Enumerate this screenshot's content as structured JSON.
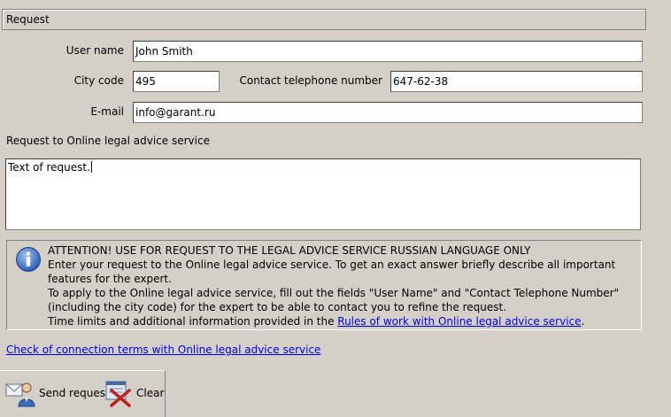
{
  "section": {
    "title": "Request"
  },
  "form": {
    "user_name_label": "User name",
    "user_name_value": "John Smith",
    "city_code_label": "City code",
    "city_code_value": "495",
    "phone_label": "Contact telephone number",
    "phone_value": "647-62-38",
    "email_label": "E-mail",
    "email_value": "info@garant.ru",
    "request_label": "Request to Online legal advice service",
    "request_text": "Text of request."
  },
  "notice": {
    "icon": "info-icon",
    "heading": "ATTENTION! USE FOR REQUEST TO THE LEGAL ADVICE SERVICE RUSSIAN LANGUAGE ONLY",
    "line1": "Enter your request to the Online legal advice service. To get an exact answer briefly describe all important features for the expert.",
    "line2": "To apply to the Online legal advice service, fill out the fields \"User Name\" and \"Contact Telephone Number\" (including the city code) for the expert to be able to contact you to refine the request.",
    "line3_prefix": "Time limits and additional information provided in the ",
    "rules_link": "Rules of work with Online legal advice service",
    "line3_suffix": "."
  },
  "check_link": "Check of connection terms with Online legal advice service",
  "toolbar": {
    "send_label": "Send request",
    "send_icon": "send-request-icon",
    "clear_label": "Clear",
    "clear_icon": "clear-icon"
  }
}
